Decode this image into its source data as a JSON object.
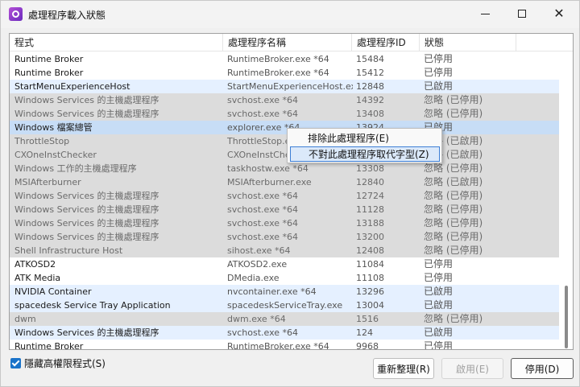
{
  "window": {
    "title": "處理程序載入狀態",
    "minimize_icon": "minimize-icon",
    "maximize_icon": "maximize-icon",
    "close_icon": "close-icon"
  },
  "columns": [
    "程式",
    "處理程序名稱",
    "處理程序ID",
    "狀態"
  ],
  "rows": [
    {
      "name": "Runtime Broker",
      "file": "RuntimeBroker.exe *64",
      "pid": "15484",
      "status": "已停用",
      "style": "normal"
    },
    {
      "name": "Runtime Broker",
      "file": "RuntimeBroker.exe *64",
      "pid": "15412",
      "status": "已停用",
      "style": "normal"
    },
    {
      "name": "StartMenuExperienceHost",
      "file": "StartMenuExperienceHost.exe...",
      "pid": "12848",
      "status": "已啟用",
      "style": "blue"
    },
    {
      "name": "Windows Services 的主機處理程序",
      "file": "svchost.exe *64",
      "pid": "14392",
      "status": "忽略 (已停用)",
      "style": "gray"
    },
    {
      "name": "Windows Services 的主機處理程序",
      "file": "svchost.exe *64",
      "pid": "13408",
      "status": "忽略 (已停用)",
      "style": "gray"
    },
    {
      "name": "Windows 檔案總管",
      "file": "explorer.exe *64",
      "pid": "13924",
      "status": "已啟用",
      "style": "selected"
    },
    {
      "name": "ThrottleStop",
      "file": "ThrottleStop.exe",
      "pid": "",
      "status": "忽略 (已啟用)",
      "style": "gray"
    },
    {
      "name": "CXOneInstChecker",
      "file": "CXOneInstChecker",
      "pid": "",
      "status": "忽略 (已啟用)",
      "style": "gray"
    },
    {
      "name": "Windows 工作的主機處理程序",
      "file": "taskhostw.exe *64",
      "pid": "13308",
      "status": "忽略 (已停用)",
      "style": "gray"
    },
    {
      "name": "MSIAfterburner",
      "file": "MSIAfterburner.exe",
      "pid": "12840",
      "status": "忽略 (已啟用)",
      "style": "gray"
    },
    {
      "name": "Windows Services 的主機處理程序",
      "file": "svchost.exe *64",
      "pid": "12724",
      "status": "忽略 (已停用)",
      "style": "gray"
    },
    {
      "name": "Windows Services 的主機處理程序",
      "file": "svchost.exe *64",
      "pid": "11128",
      "status": "忽略 (已停用)",
      "style": "gray"
    },
    {
      "name": "Windows Services 的主機處理程序",
      "file": "svchost.exe *64",
      "pid": "13188",
      "status": "忽略 (已停用)",
      "style": "gray"
    },
    {
      "name": "Windows Services 的主機處理程序",
      "file": "svchost.exe *64",
      "pid": "13200",
      "status": "忽略 (已停用)",
      "style": "gray"
    },
    {
      "name": "Shell Infrastructure Host",
      "file": "sihost.exe *64",
      "pid": "12408",
      "status": "忽略 (已停用)",
      "style": "gray"
    },
    {
      "name": "ATKOSD2",
      "file": "ATKOSD2.exe",
      "pid": "11084",
      "status": "已停用",
      "style": "normal"
    },
    {
      "name": "ATK Media",
      "file": "DMedia.exe",
      "pid": "11108",
      "status": "已停用",
      "style": "normal"
    },
    {
      "name": "NVIDIA Container",
      "file": "nvcontainer.exe *64",
      "pid": "13296",
      "status": "已啟用",
      "style": "blue"
    },
    {
      "name": "spacedesk Service Tray Application",
      "file": "spacedeskServiceTray.exe",
      "pid": "13004",
      "status": "已啟用",
      "style": "blue"
    },
    {
      "name": "dwm",
      "file": "dwm.exe *64",
      "pid": "1516",
      "status": "忽略 (已停用)",
      "style": "gray"
    },
    {
      "name": "Windows Services 的主機處理程序",
      "file": "svchost.exe *64",
      "pid": "124",
      "status": "已啟用",
      "style": "blue"
    },
    {
      "name": "Runtime Broker",
      "file": "RuntimeBroker.exe *64",
      "pid": "9968",
      "status": "已停用",
      "style": "normal"
    }
  ],
  "context_menu": {
    "items": [
      "排除此處理程序(E)",
      "不對此處理程序取代字型(Z)"
    ]
  },
  "footer": {
    "checkbox_label": "隱藏高權限程式(S)",
    "checkbox_checked": true,
    "buttons": {
      "rearrange": "重新整理(R)",
      "enable": "啟用(E)",
      "disable": "停用(D)"
    }
  },
  "colors": {
    "selected_row": "#c7ddf6",
    "enabled_row": "#e5f0ff",
    "ignored_row": "#dcdcdc",
    "checkbox": "#1a73c9"
  }
}
